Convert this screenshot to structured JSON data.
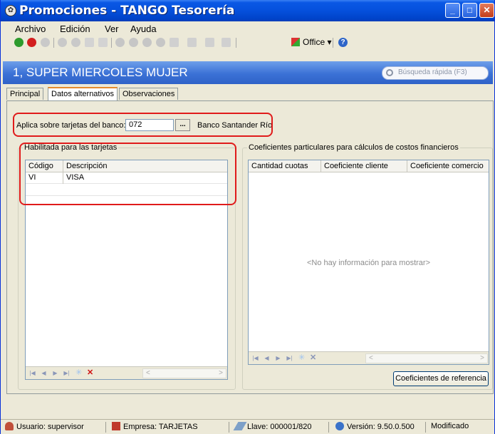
{
  "window": {
    "title": "Promociones - TANGO Tesorería",
    "icon": "tango-app-icon"
  },
  "menu": {
    "items": [
      "Archivo",
      "Edición",
      "Ver",
      "Ayuda"
    ]
  },
  "toolbar": {
    "office_label": "Office",
    "icons": [
      "ok-icon",
      "cancel-icon",
      "add-icon",
      "delete-icon",
      "save-icon",
      "print-icon",
      "first-icon",
      "previous-icon",
      "next-icon",
      "last-icon",
      "export-icon",
      "filter-icon",
      "view-icon",
      "sort-icon",
      "office-icon",
      "help-icon"
    ]
  },
  "record": {
    "title": "1, SUPER MIERCOLES MUJER",
    "search_placeholder": "Búsqueda rápida (F3)"
  },
  "tabs": [
    {
      "label": "Principal",
      "active": false
    },
    {
      "label": "Datos alternativos",
      "active": true
    },
    {
      "label": "Observaciones",
      "active": false
    }
  ],
  "bank": {
    "label": "Aplica sobre tarjetas del banco:",
    "code": "072",
    "lookup_label": "...",
    "name": "Banco Santander Río"
  },
  "cards_group": {
    "title": "Habilitada para las tarjetas",
    "columns": [
      "Código",
      "Descripción"
    ],
    "rows": [
      {
        "codigo": "VI",
        "descripcion": "VISA"
      }
    ]
  },
  "coef_group": {
    "title": "Coeficientes particulares para cálculos de costos financieros",
    "columns": [
      "Cantidad cuotas",
      "Coeficiente cliente",
      "Coeficiente comercio"
    ],
    "empty_message": "<No hay información para mostrar>",
    "button_label": "Coeficientes de referencia"
  },
  "status": {
    "usuario": "Usuario: supervisor",
    "empresa": "Empresa: TARJETAS",
    "llave": "Llave: 000001/820",
    "version": "Versión: 9.50.0.500",
    "estado": "Modificado"
  },
  "colors": {
    "titlebar": "#0550dc",
    "record_header": "#3b71d6",
    "highlight_oval": "#e01b1b",
    "active_tab": "#e68b2c"
  }
}
